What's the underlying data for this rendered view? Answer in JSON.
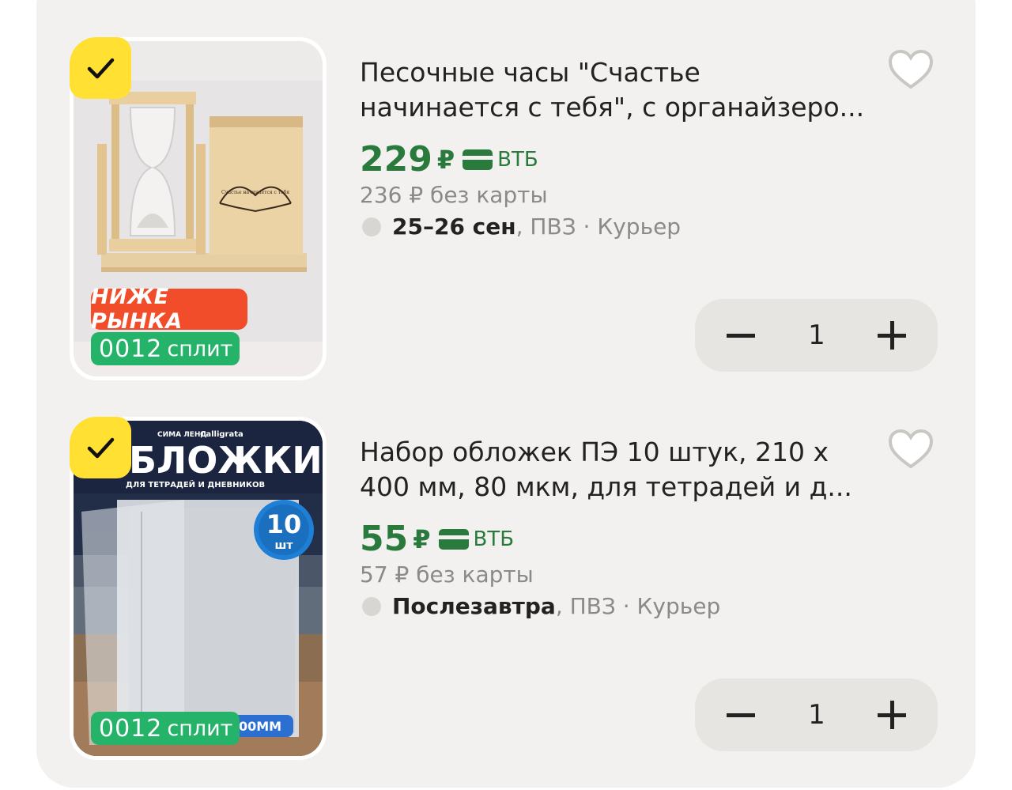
{
  "colors": {
    "accent_green": "#2a7a3e",
    "check_yellow": "#ffe033",
    "badge_red": "#f24d2a",
    "split_green": "#25b36a"
  },
  "items": [
    {
      "title": "Песочные часы \"Счастье\nначинается с тебя\", с органайзеро...",
      "price": "229",
      "currency": "₽",
      "bank": "ВТБ",
      "old_price": "236 ₽  без карты",
      "delivery_date": "25–26 сен",
      "delivery_rest": ", ПВЗ · Курьер",
      "quantity": "1",
      "badge_market": "НИЖЕ РЫНКА",
      "badge_split_digits": "0012",
      "badge_split_text": "сплит",
      "image_text": "Счастье начинается с тебя",
      "icons": [
        "check-icon",
        "heart-icon",
        "minus-icon",
        "plus-icon",
        "card-icon"
      ]
    },
    {
      "title": "Набор обложек ПЭ 10 штук, 210 х\n400 мм, 80 мкм, для тетрадей и д...",
      "price": "55",
      "currency": "₽",
      "bank": "ВТБ",
      "old_price": "57 ₽  без карты",
      "delivery_date": "Послезавтра",
      "delivery_rest": ", ПВЗ · Курьер",
      "quantity": "1",
      "badge_split_digits": "0012",
      "badge_split_text": "сплит",
      "image_brand": "СИМА ЛЕНД",
      "image_brand2": "Calligrata",
      "image_title": "БЛОЖКИ",
      "image_subtitle": "ДЛЯ ТЕТРАДЕЙ И ДНЕВНИКОВ",
      "image_count": "10",
      "image_count_unit": "шт",
      "image_size": "00ММ",
      "icons": [
        "check-icon",
        "heart-icon",
        "minus-icon",
        "plus-icon",
        "card-icon"
      ]
    }
  ]
}
